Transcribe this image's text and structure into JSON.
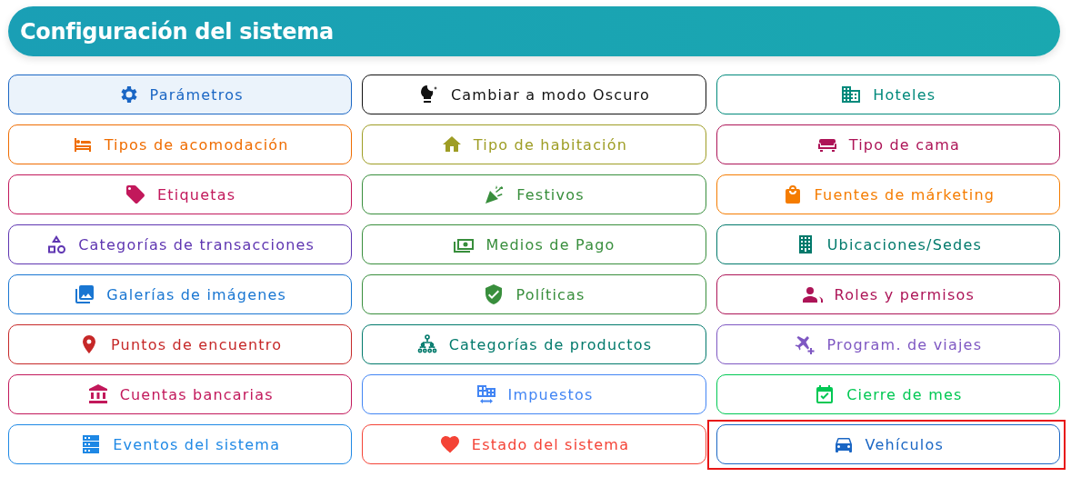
{
  "header": {
    "title": "Configuración del sistema"
  },
  "buttons": [
    {
      "label": "Parámetros",
      "color": "#1a66c4",
      "selected": true,
      "highlighted": false
    },
    {
      "label": "Cambiar a modo Oscuro",
      "color": "#111111",
      "selected": false,
      "highlighted": false
    },
    {
      "label": "Hoteles",
      "color": "#00897b",
      "selected": false,
      "highlighted": false
    },
    {
      "label": "Tipos de acomodación",
      "color": "#ef6c00",
      "selected": false,
      "highlighted": false
    },
    {
      "label": "Tipo de habitación",
      "color": "#9e9d24",
      "selected": false,
      "highlighted": false
    },
    {
      "label": "Tipo de cama",
      "color": "#ad1457",
      "selected": false,
      "highlighted": false
    },
    {
      "label": "Etiquetas",
      "color": "#c2185b",
      "selected": false,
      "highlighted": false
    },
    {
      "label": "Festivos",
      "color": "#388e3c",
      "selected": false,
      "highlighted": false
    },
    {
      "label": "Fuentes de márketing",
      "color": "#f57c00",
      "selected": false,
      "highlighted": false
    },
    {
      "label": "Categorías de transacciones",
      "color": "#5e35b1",
      "selected": false,
      "highlighted": false
    },
    {
      "label": "Medios de Pago",
      "color": "#388e3c",
      "selected": false,
      "highlighted": false
    },
    {
      "label": "Ubicaciones/Sedes",
      "color": "#00796b",
      "selected": false,
      "highlighted": false
    },
    {
      "label": "Galerías de imágenes",
      "color": "#1976d2",
      "selected": false,
      "highlighted": false
    },
    {
      "label": "Políticas",
      "color": "#388e3c",
      "selected": false,
      "highlighted": false
    },
    {
      "label": "Roles y permisos",
      "color": "#ad1457",
      "selected": false,
      "highlighted": false
    },
    {
      "label": "Puntos de encuentro",
      "color": "#c62828",
      "selected": false,
      "highlighted": false
    },
    {
      "label": "Categorías de productos",
      "color": "#00796b",
      "selected": false,
      "highlighted": false
    },
    {
      "label": "Program. de viajes",
      "color": "#7e57c2",
      "selected": false,
      "highlighted": false
    },
    {
      "label": "Cuentas bancarias",
      "color": "#c2185b",
      "selected": false,
      "highlighted": false
    },
    {
      "label": "Impuestos",
      "color": "#4285f4",
      "selected": false,
      "highlighted": false
    },
    {
      "label": "Cierre de mes",
      "color": "#00c853",
      "selected": false,
      "highlighted": false
    },
    {
      "label": "Eventos del sistema",
      "color": "#1e88e5",
      "selected": false,
      "highlighted": false
    },
    {
      "label": "Estado del sistema",
      "color": "#f44336",
      "selected": false,
      "highlighted": false
    },
    {
      "label": "Vehículos",
      "color": "#1a66c4",
      "selected": false,
      "highlighted": true
    }
  ]
}
